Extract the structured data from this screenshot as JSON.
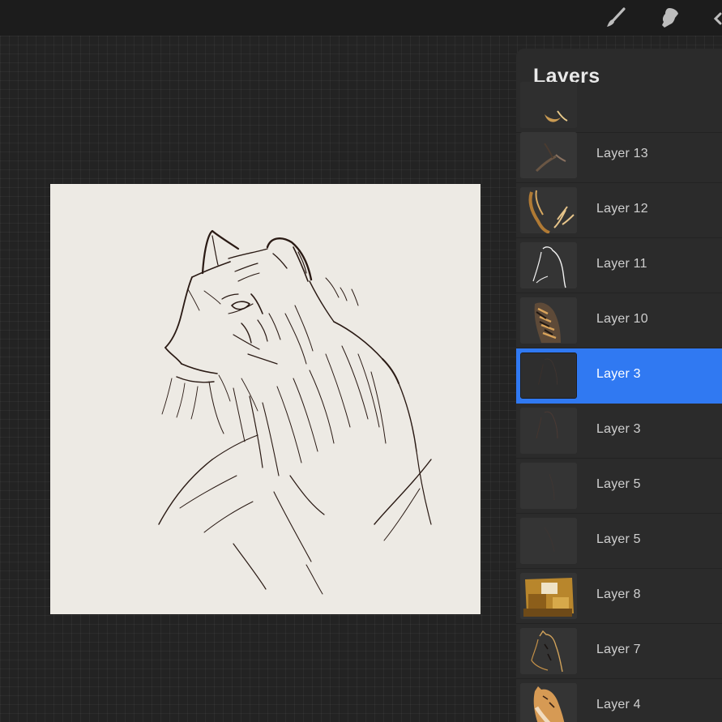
{
  "toolbar": {
    "tools": [
      {
        "name": "brush",
        "icon": "brush-icon"
      },
      {
        "name": "smudge",
        "icon": "smudge-icon"
      },
      {
        "name": "eraser",
        "icon": "eraser-icon"
      }
    ]
  },
  "layers_panel": {
    "title": "Layers",
    "layers": [
      {
        "label": "",
        "thumbnail": "gold-fragment",
        "selected": false
      },
      {
        "label": "Layer 13",
        "thumbnail": "dark-strokes",
        "selected": false
      },
      {
        "label": "Layer 12",
        "thumbnail": "gold-strokes",
        "selected": false
      },
      {
        "label": "Layer 11",
        "thumbnail": "white-outline",
        "selected": false
      },
      {
        "label": "Layer 10",
        "thumbnail": "tiger-stripes",
        "selected": false
      },
      {
        "label": "Layer 3",
        "thumbnail": "faint-sketch",
        "selected": true
      },
      {
        "label": "Layer 3",
        "thumbnail": "faint-sketch",
        "selected": false
      },
      {
        "label": "Layer 5",
        "thumbnail": "faint-sketch",
        "selected": false
      },
      {
        "label": "Layer 5",
        "thumbnail": "faint-sketch",
        "selected": false
      },
      {
        "label": "Layer 8",
        "thumbnail": "gold-blocks",
        "selected": false
      },
      {
        "label": "Layer 7",
        "thumbnail": "tiger-outline",
        "selected": false
      },
      {
        "label": "Layer 4",
        "thumbnail": "tiger-color",
        "selected": false
      }
    ]
  },
  "colors": {
    "selected_row": "#3079f2",
    "panel": "#2b2b2b",
    "canvas": "#edeae4",
    "ink": "#2a1a14"
  }
}
